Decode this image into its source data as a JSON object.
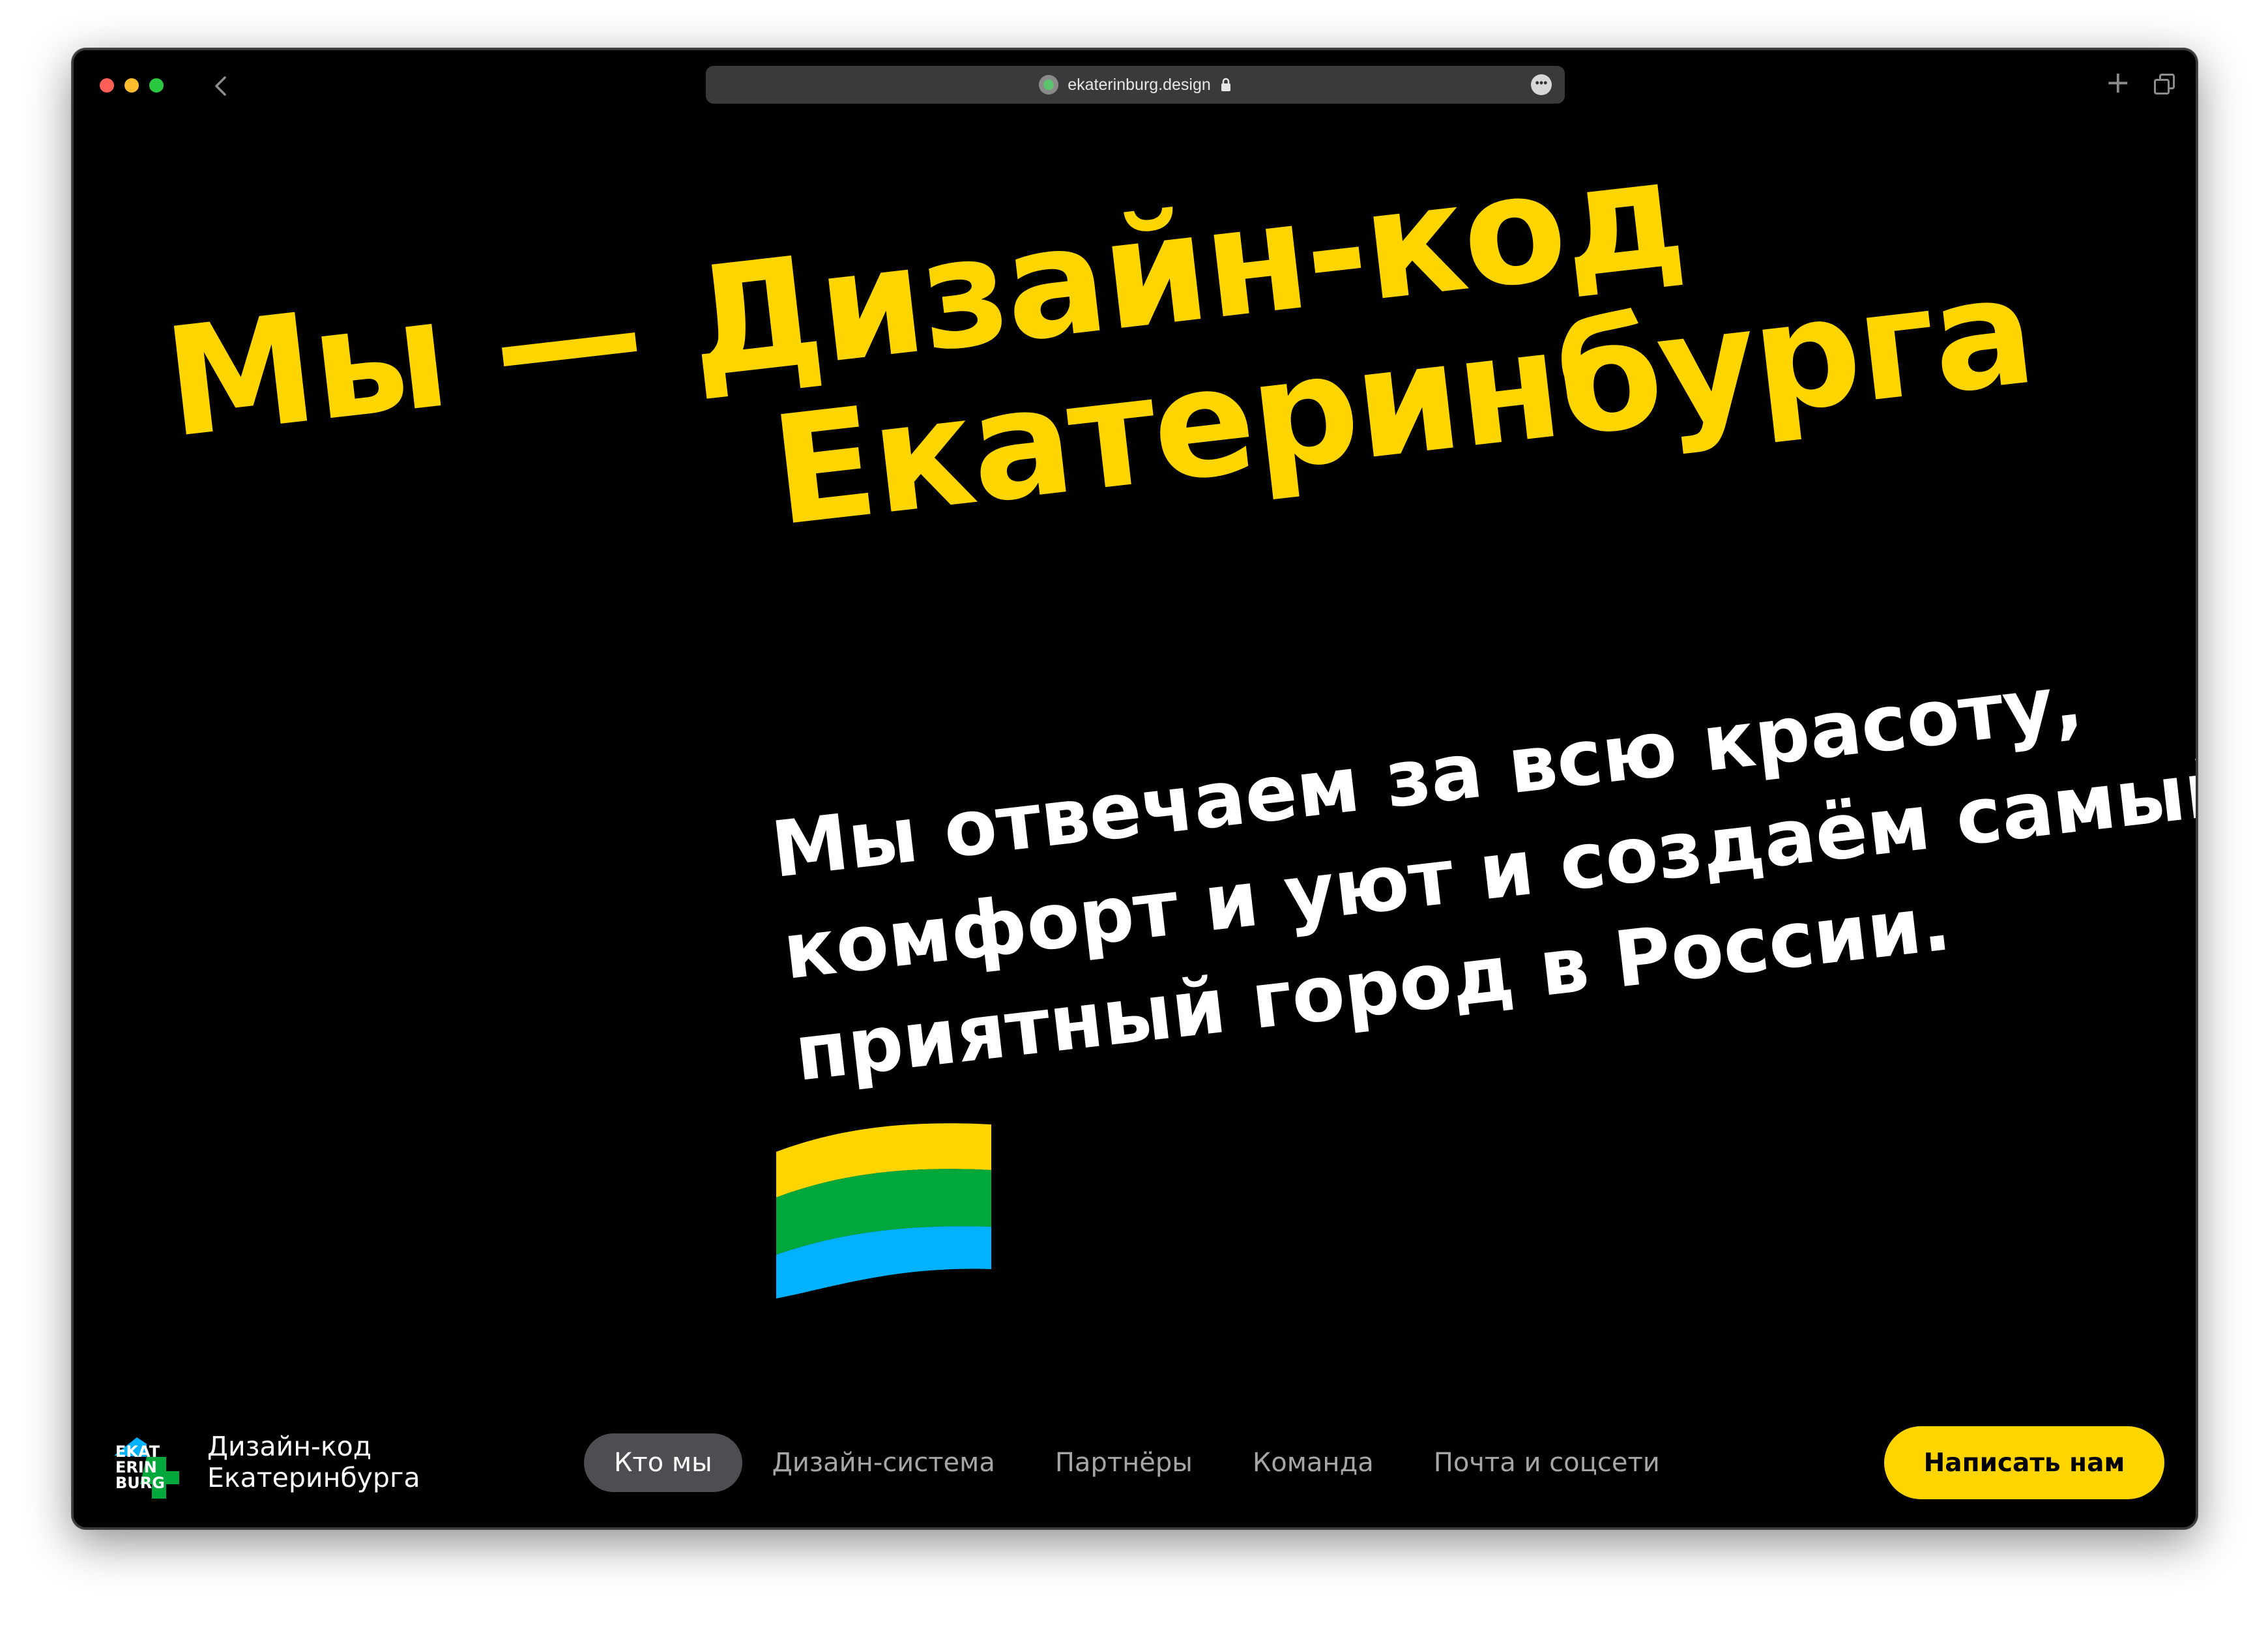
{
  "browser": {
    "url": "ekaterinburg.design",
    "lock_icon": "lock-icon",
    "site_icon": "site-favicon-icon",
    "more_icon": "ellipsis-icon",
    "back_icon": "chevron-left-icon",
    "new_tab_icon": "plus-icon",
    "tabs_icon": "tabs-overview-icon"
  },
  "hero": {
    "headline_line1": "Мы — Дизайн-код",
    "headline_line2": "Екатеринбурга",
    "subheading": "Мы отвечаем за всю красоту, комфорт и уют и создаём самый приятный город в России.",
    "flag_colors": [
      "#ffd500",
      "#00a83c",
      "#00b2ff"
    ]
  },
  "footer": {
    "logo_text_line1": "Дизайн-код",
    "logo_text_line2": "Екатеринбурга",
    "logo_mark_text": [
      "EKAT",
      "ERIN",
      "BURG"
    ],
    "nav": [
      {
        "label": "Кто мы",
        "active": true
      },
      {
        "label": "Дизайн-система",
        "active": false
      },
      {
        "label": "Партнёры",
        "active": false
      },
      {
        "label": "Команда",
        "active": false
      },
      {
        "label": "Почта и соцсети",
        "active": false
      }
    ],
    "cta_label": "Написать нам"
  },
  "colors": {
    "accent": "#ffd500",
    "background": "#000000",
    "text": "#ffffff"
  }
}
